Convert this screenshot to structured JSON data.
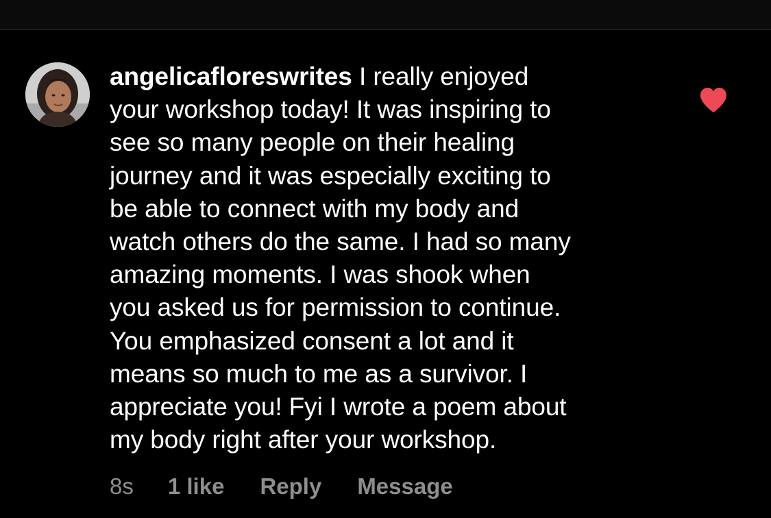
{
  "comment": {
    "username": "angelicafloreswrites",
    "text": "I really enjoyed\nyour workshop today! It was inspiring to\nsee so many people on their healing\njourney and it was especially exciting to\nbe able to connect with my body and\nwatch others do the same. I had so many\namazing moments. I was shook when\nyou asked us for permission to continue.\nYou emphasized consent a lot and it\nmeans so much to me as a survivor. I\nappreciate you! Fyi I wrote a poem about\nmy body right after your workshop.",
    "liked": true,
    "like_color": "#ed4956",
    "timestamp": "8s",
    "likes_label": "1 like",
    "reply_label": "Reply",
    "message_label": "Message"
  },
  "icons": {
    "like": "heart-icon",
    "avatar": "user-avatar"
  },
  "colors": {
    "background": "#000000",
    "text": "#ffffff",
    "muted": "#8e8e8e"
  }
}
